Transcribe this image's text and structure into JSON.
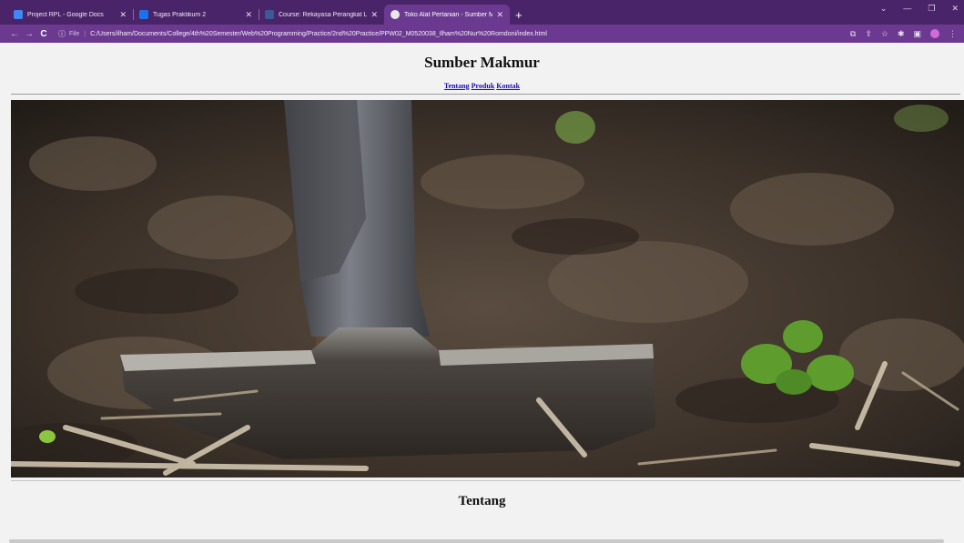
{
  "browser": {
    "tabs": [
      {
        "title": "Project RPL - Google Docs",
        "color": "#4285f4"
      },
      {
        "title": "Tugas Praktikum 2",
        "color": "#1a73e8"
      },
      {
        "title": "Course: Rekayasa Perangkat Luna",
        "color": "#3d5a98"
      },
      {
        "title": "Toko Alat Pertanian - Sumber Ma",
        "color": "#e8e8e8"
      }
    ],
    "new_tab": "+",
    "address": {
      "scheme": "File",
      "url": "C:/Users/ilham/Documents/College/4th%20Semester/Web%20Programming/Practice/2nd%20Practice/PPW02_M0520038_Ilham%20Nur%20Romdoni/index.html"
    }
  },
  "page": {
    "title": "Sumber Makmur",
    "nav": [
      "Tentang",
      "Produk",
      "Kontak"
    ],
    "section_title": "Tentang"
  }
}
